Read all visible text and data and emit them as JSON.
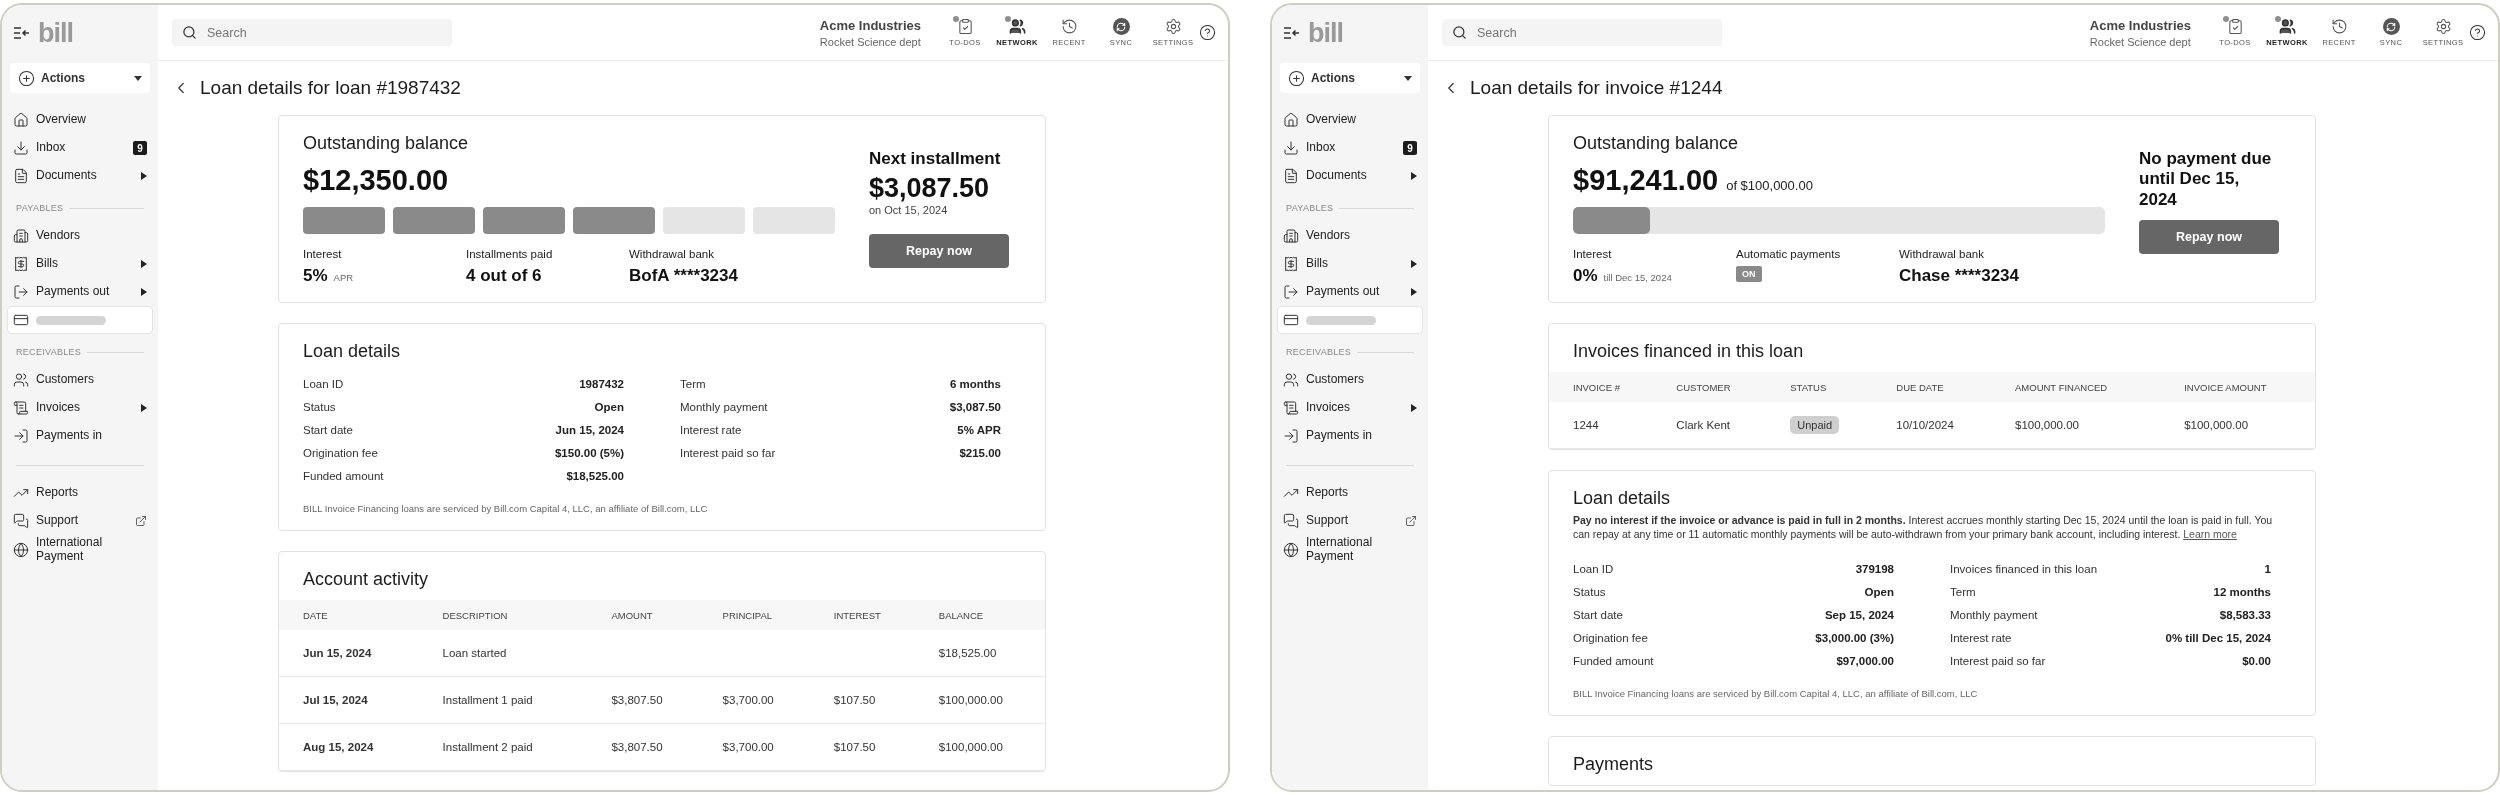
{
  "windows": [
    {
      "sidebar": {
        "logo": "bill",
        "actions": "Actions",
        "items": [
          {
            "kind": "item",
            "label": "Overview",
            "submenu": false,
            "external": false,
            "selected": false
          },
          {
            "kind": "item",
            "label": "Inbox",
            "badge": "9",
            "submenu": false,
            "external": false,
            "selected": false
          },
          {
            "kind": "item",
            "label": "Documents",
            "submenu": true,
            "external": false,
            "selected": false
          },
          {
            "kind": "section",
            "label": "PAYABLES"
          },
          {
            "kind": "item",
            "label": "Vendors",
            "submenu": false,
            "external": false,
            "selected": false
          },
          {
            "kind": "item",
            "label": "Bills",
            "submenu": true,
            "external": false,
            "selected": false
          },
          {
            "kind": "item",
            "label": "Payments out",
            "submenu": true,
            "external": false,
            "selected": false
          },
          {
            "kind": "skeleton",
            "selected": true
          },
          {
            "kind": "section",
            "label": "RECEIVABLES"
          },
          {
            "kind": "item",
            "label": "Customers",
            "submenu": false,
            "external": false,
            "selected": false
          },
          {
            "kind": "item",
            "label": "Invoices",
            "submenu": true,
            "external": false,
            "selected": false
          },
          {
            "kind": "item",
            "label": "Payments in",
            "submenu": false,
            "external": false,
            "selected": false
          },
          {
            "kind": "divider"
          },
          {
            "kind": "item",
            "label": "Reports",
            "submenu": false,
            "external": false,
            "selected": false
          },
          {
            "kind": "item",
            "label": "Support",
            "submenu": false,
            "external": true,
            "selected": false
          },
          {
            "kind": "item",
            "label": "International Payment",
            "submenu": false,
            "external": false,
            "selected": false
          }
        ]
      },
      "topbar": {
        "search": {
          "placeholder": "Search"
        },
        "company": "Acme Industries",
        "department": "Rocket Science dept",
        "nav": [
          {
            "label": "TO-DOS",
            "dot": true,
            "selected": false
          },
          {
            "label": "NETWORK",
            "dot": true,
            "selected": true
          },
          {
            "label": "RECENT",
            "dot": false,
            "selected": false
          },
          {
            "label": "SYNC",
            "dot": false,
            "selected": false
          },
          {
            "label": "SETTINGS",
            "dot": false,
            "selected": false
          }
        ]
      },
      "page_title": "Loan details for loan #1987432",
      "summary": {
        "title": "Outstanding balance",
        "amount": "$12,350.00",
        "progress": {
          "kind": "segments",
          "segments": [
            {
              "filled": true
            },
            {
              "filled": true
            },
            {
              "filled": true
            },
            {
              "filled": true
            },
            {
              "filled": false
            },
            {
              "filled": false
            }
          ]
        },
        "stats": [
          {
            "kind": "value",
            "label": "Interest",
            "value": "5%",
            "note": "APR"
          },
          {
            "kind": "value",
            "label": "Installments paid",
            "value": "4 out of 6"
          },
          {
            "kind": "value",
            "label": "Withdrawal bank",
            "value": "BofA ****3234"
          }
        ],
        "side": {
          "heading": "Next installment",
          "amount": "$3,087.50",
          "note": "on Oct 15, 2024",
          "button": "Repay now"
        }
      },
      "sections": [
        {
          "kind": "details",
          "title": "Loan details",
          "left_fields": [
            {
              "label": "Loan ID",
              "value": "1987432"
            },
            {
              "label": "Status",
              "value": "Open"
            },
            {
              "label": "Start date",
              "value": "Jun 15, 2024"
            },
            {
              "label": "Origination fee",
              "value": "$150.00 (5%)"
            },
            {
              "label": "Funded amount",
              "value": "$18,525.00"
            }
          ],
          "right_fields": [
            {
              "label": "Term",
              "value": "6 months"
            },
            {
              "label": "Monthly payment",
              "value": "$3,087.50"
            },
            {
              "label": "Interest rate",
              "value": "5% APR"
            },
            {
              "label": "Interest paid so far",
              "value": "$215.00"
            }
          ],
          "footnote": "BILL Invoice Financing loans are serviced by Bill.com Capital 4, LLC, an affiliate of Bill.com, LLC"
        },
        {
          "kind": "table",
          "title": "Account activity",
          "columns": [
            {
              "label": "DATE",
              "kind": "bold"
            },
            {
              "label": "DESCRIPTION",
              "kind": "text"
            },
            {
              "label": "AMOUNT",
              "kind": "text"
            },
            {
              "label": "PRINCIPAL",
              "kind": "text"
            },
            {
              "label": "INTEREST",
              "kind": "text"
            },
            {
              "label": "BALANCE",
              "kind": "text"
            }
          ],
          "rows": [
            [
              "Jun 15, 2024",
              "Loan started",
              null,
              null,
              null,
              "$18,525.00"
            ],
            [
              "Jul 15, 2024",
              "Installment 1 paid",
              "$3,807.50",
              "$3,700.00",
              "$107.50",
              "$100,000.00"
            ],
            [
              "Aug 15, 2024",
              "Installment 2 paid",
              "$3,807.50",
              "$3,700.00",
              "$107.50",
              "$100,000.00"
            ]
          ]
        }
      ]
    },
    {
      "sidebar": {
        "logo": "bill",
        "actions": "Actions",
        "items": [
          {
            "kind": "item",
            "label": "Overview",
            "submenu": false,
            "external": false,
            "selected": false
          },
          {
            "kind": "item",
            "label": "Inbox",
            "badge": "9",
            "submenu": false,
            "external": false,
            "selected": false
          },
          {
            "kind": "item",
            "label": "Documents",
            "submenu": true,
            "external": false,
            "selected": false
          },
          {
            "kind": "section",
            "label": "PAYABLES"
          },
          {
            "kind": "item",
            "label": "Vendors",
            "submenu": false,
            "external": false,
            "selected": false
          },
          {
            "kind": "item",
            "label": "Bills",
            "submenu": true,
            "external": false,
            "selected": false
          },
          {
            "kind": "item",
            "label": "Payments out",
            "submenu": true,
            "external": false,
            "selected": false
          },
          {
            "kind": "skeleton",
            "selected": true
          },
          {
            "kind": "section",
            "label": "RECEIVABLES"
          },
          {
            "kind": "item",
            "label": "Customers",
            "submenu": false,
            "external": false,
            "selected": false
          },
          {
            "kind": "item",
            "label": "Invoices",
            "submenu": true,
            "external": false,
            "selected": false
          },
          {
            "kind": "item",
            "label": "Payments in",
            "submenu": false,
            "external": false,
            "selected": false
          },
          {
            "kind": "divider"
          },
          {
            "kind": "item",
            "label": "Reports",
            "submenu": false,
            "external": false,
            "selected": false
          },
          {
            "kind": "item",
            "label": "Support",
            "submenu": false,
            "external": true,
            "selected": false
          },
          {
            "kind": "item",
            "label": "International Payment",
            "submenu": false,
            "external": false,
            "selected": false
          }
        ]
      },
      "topbar": {
        "search": {
          "placeholder": "Search"
        },
        "company": "Acme Industries",
        "department": "Rocket Science dept",
        "nav": [
          {
            "label": "TO-DOS",
            "dot": true,
            "selected": false
          },
          {
            "label": "NETWORK",
            "dot": true,
            "selected": true
          },
          {
            "label": "RECENT",
            "dot": false,
            "selected": false
          },
          {
            "label": "SYNC",
            "dot": false,
            "selected": false
          },
          {
            "label": "SETTINGS",
            "dot": false,
            "selected": false
          }
        ]
      },
      "page_title": "Loan details for invoice #1244",
      "summary": {
        "title": "Outstanding balance",
        "amount": "$91,241.00",
        "amount_note": "of $100,000.00",
        "progress": {
          "kind": "bar",
          "level": 0.145
        },
        "stats": [
          {
            "kind": "value",
            "label": "Interest",
            "value": "0%",
            "note": "till Dec 15, 2024"
          },
          {
            "kind": "badge",
            "label": "Automatic payments",
            "value": "ON"
          },
          {
            "kind": "value",
            "label": "Withdrawal bank",
            "value": "Chase ****3234"
          }
        ],
        "side": {
          "heading": "No payment due until Dec 15, 2024",
          "button": "Repay now"
        }
      },
      "sections": [
        {
          "kind": "table",
          "title": "Invoices financed in this loan",
          "columns": [
            {
              "label": "INVOICE #",
              "kind": "text"
            },
            {
              "label": "CUSTOMER",
              "kind": "text"
            },
            {
              "label": "STATUS",
              "kind": "badge"
            },
            {
              "label": "DUE DATE",
              "kind": "text"
            },
            {
              "label": "AMOUNT FINANCED",
              "kind": "text"
            },
            {
              "label": "INVOICE AMOUNT",
              "kind": "text"
            }
          ],
          "rows": [
            [
              "1244",
              "Clark Kent",
              "Unpaid",
              "10/10/2024",
              "$100,000.00",
              "$100,000.00"
            ]
          ]
        },
        {
          "kind": "details",
          "title": "Loan details",
          "intro": "**Pay no interest if the invoice or advance is paid in full in 2 months.** Interest accrues monthly starting Dec 15, 2024 until the loan is paid in full. You can repay at any time or 11 automatic monthly payments will be auto-withdrawn from your primary bank account, including interest.",
          "intro_link": "Learn more",
          "left_fields": [
            {
              "label": "Loan ID",
              "value": "379198"
            },
            {
              "label": "Status",
              "value": "Open"
            },
            {
              "label": "Start date",
              "value": "Sep 15, 2024"
            },
            {
              "label": "Origination fee",
              "value": "$3,000.00 (3%)"
            },
            {
              "label": "Funded amount",
              "value": "$97,000.00"
            }
          ],
          "right_fields": [
            {
              "label": "Invoices financed in this loan",
              "value": "1"
            },
            {
              "label": "Term",
              "value": "12 months"
            },
            {
              "label": "Monthly payment",
              "value": "$8,583.33"
            },
            {
              "label": "Interest rate",
              "value": "0% till Dec 15, 2024"
            },
            {
              "label": "Interest paid so far",
              "value": "$0.00"
            }
          ],
          "footnote": "BILL Invoice Financing loans are serviced by Bill.com Capital 4, LLC, an affiliate of Bill.com, LLC"
        },
        {
          "kind": "table",
          "title": "Payments"
        }
      ]
    }
  ]
}
